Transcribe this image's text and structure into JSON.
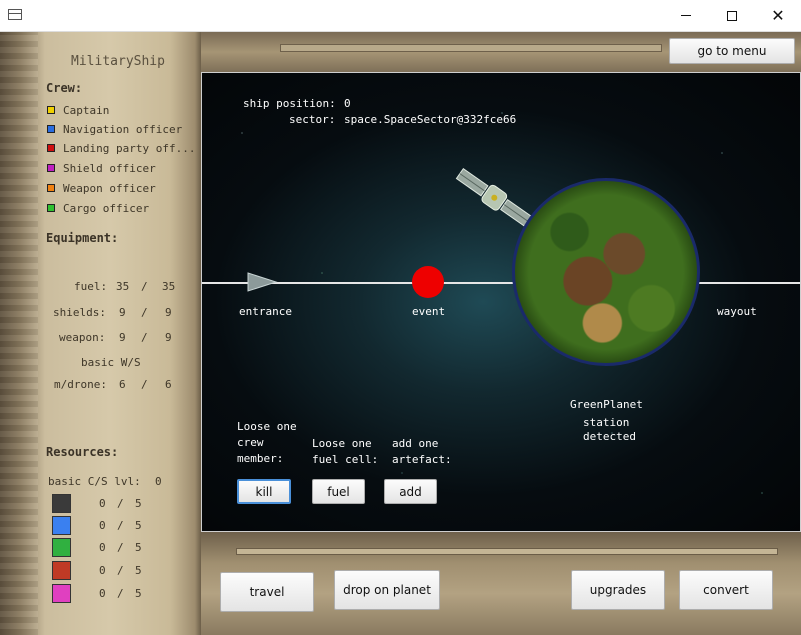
{
  "window": {
    "minimize_icon": "minimize-icon",
    "maximize_icon": "maximize-icon",
    "close_label": "✕"
  },
  "menu_button": "go to menu",
  "sidebar": {
    "ship_name": "MilitaryShip",
    "crew_heading": "Crew:",
    "crew": [
      {
        "label": "Captain",
        "color": "#f0d000"
      },
      {
        "label": "Navigation officer",
        "color": "#2a6de0"
      },
      {
        "label": "Landing party off...",
        "color": "#d01010"
      },
      {
        "label": "Shield officer",
        "color": "#c020c0"
      },
      {
        "label": "Weapon officer",
        "color": "#f08010"
      },
      {
        "label": "Cargo officer",
        "color": "#30c030"
      }
    ],
    "equipment_heading": "Equipment:",
    "equipment": [
      {
        "name": "fuel:",
        "current": "35",
        "max": "35"
      },
      {
        "name": "shields:",
        "current": "9",
        "max": "9"
      },
      {
        "name": "weapon:",
        "current": "9",
        "max": "9"
      }
    ],
    "basic_ws": "basic W/S",
    "drone": {
      "name": "m/drone:",
      "current": "6",
      "max": "6"
    },
    "resources_heading": "Resources:",
    "basic_cs": "basic C/S lvl:",
    "basic_cs_level": "0",
    "resources": [
      {
        "color": "#3a3a3a",
        "current": "0",
        "max": "5"
      },
      {
        "color": "#3a80f0",
        "current": "0",
        "max": "5"
      },
      {
        "color": "#30b040",
        "current": "0",
        "max": "5"
      },
      {
        "color": "#c03a25",
        "current": "0",
        "max": "5"
      },
      {
        "color": "#e040c0",
        "current": "0",
        "max": "5"
      }
    ]
  },
  "space": {
    "position_label": "ship position:",
    "position_value": "0",
    "sector_label": "sector:",
    "sector_value": "space.SpaceSector@332fce66",
    "entrance": "entrance",
    "event": "event",
    "wayout": "wayout",
    "planet_name": "GreenPlanet",
    "station_line1": "station",
    "station_line2": "detected",
    "actions": [
      {
        "lines": [
          "Loose one",
          "crew",
          "member:"
        ],
        "button": "kill"
      },
      {
        "lines": [
          "Loose one",
          "fuel cell:"
        ],
        "button": "fuel"
      },
      {
        "lines": [
          "add one",
          "artefact:"
        ],
        "button": "add"
      }
    ]
  },
  "bottom_buttons": [
    "travel",
    "drop on planet",
    "upgrades",
    "convert"
  ]
}
